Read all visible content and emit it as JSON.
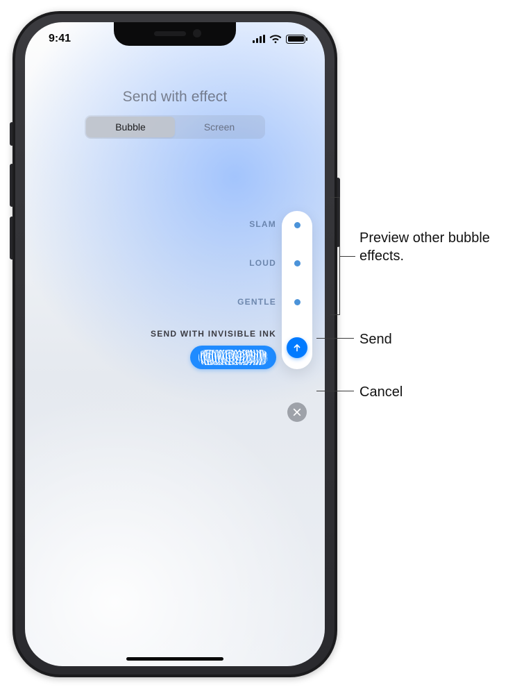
{
  "status": {
    "time": "9:41"
  },
  "header": {
    "title": "Send with effect",
    "tabs": {
      "bubble": "Bubble",
      "screen": "Screen"
    }
  },
  "effects": {
    "slam": "SLAM",
    "loud": "LOUD",
    "gentle": "GENTLE",
    "selected_label": "SEND WITH INVISIBLE INK"
  },
  "callouts": {
    "preview": "Preview other bubble effects.",
    "send": "Send",
    "cancel": "Cancel"
  },
  "icons": {
    "send": "arrow-up-circle-icon",
    "cancel": "x-circle-icon"
  },
  "colors": {
    "accent": "#007aff",
    "bubble": "#1f8bff"
  }
}
